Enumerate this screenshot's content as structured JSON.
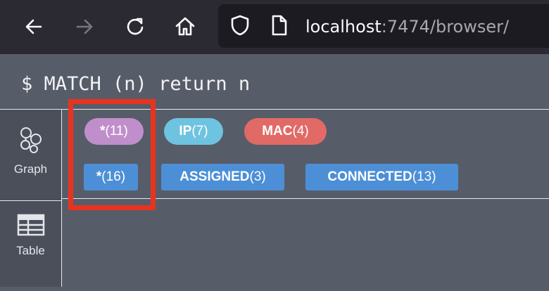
{
  "browser": {
    "url_host": "localhost",
    "url_rest": ":7474/browser/",
    "icons": [
      "back-arrow-icon",
      "forward-arrow-icon",
      "reload-icon",
      "home-icon",
      "shield-icon",
      "page-icon"
    ]
  },
  "query": {
    "text": "$ MATCH (n) return n"
  },
  "sidebar": {
    "items": [
      {
        "label": "Graph",
        "icon": "graph-icon"
      },
      {
        "label": "Table",
        "icon": "table-icon"
      }
    ]
  },
  "node_labels": [
    {
      "name": "*",
      "count": "(11)",
      "color": "#c08fcb"
    },
    {
      "name": "IP",
      "count": "(7)",
      "color": "#6ec3e0"
    },
    {
      "name": "MAC",
      "count": "(4)",
      "color": "#e16a66"
    }
  ],
  "relationship_types": [
    {
      "name": "*",
      "count": "(16)",
      "color": "#4c8fd6"
    },
    {
      "name": "ASSIGNED",
      "count": "(3)",
      "color": "#4c8fd6"
    },
    {
      "name": "CONNECTED",
      "count": "(13)",
      "color": "#4c8fd6"
    }
  ],
  "highlight_color": "#e8341f"
}
